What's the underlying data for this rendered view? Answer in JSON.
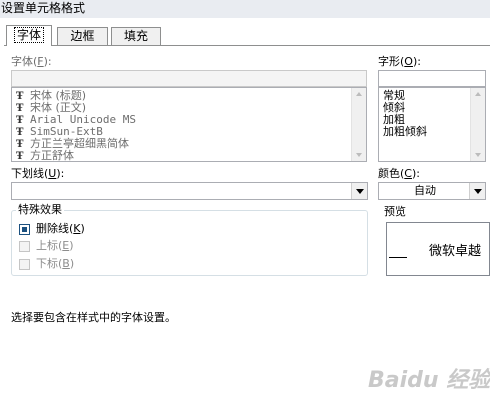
{
  "window": {
    "title": "设置单元格格式"
  },
  "tabs": [
    {
      "label": "字体",
      "active": true
    },
    {
      "label": "边框",
      "active": false
    },
    {
      "label": "填充",
      "active": false
    }
  ],
  "font": {
    "label": "字体",
    "accel": "F",
    "value": "",
    "items": [
      "宋体 (标题)",
      "宋体 (正文)",
      "Arial Unicode MS",
      "SimSun-ExtB",
      "方正兰亭超细黑简体",
      "方正舒体"
    ]
  },
  "font_style": {
    "label": "字形",
    "accel": "O",
    "value": "",
    "items": [
      "常规",
      "倾斜",
      "加粗",
      "加粗倾斜"
    ]
  },
  "underline": {
    "label": "下划线",
    "accel": "U",
    "value": ""
  },
  "color": {
    "label": "颜色",
    "accel": "C",
    "value": "自动"
  },
  "effects": {
    "title": "特殊效果",
    "strikethrough": {
      "label": "删除线",
      "accel": "K",
      "checked": true
    },
    "superscript": {
      "label": "上标",
      "accel": "E",
      "checked": false
    },
    "subscript": {
      "label": "下标",
      "accel": "B",
      "checked": false
    }
  },
  "preview": {
    "label": "预览",
    "sample": "微软卓越"
  },
  "description": "选择要包含在样式中的字体设置。",
  "watermark": "Baidu 经验",
  "colors": {
    "accent": "#1c5180",
    "tab_border": "#8e8f8f",
    "disabled_text": "#8d8d8d"
  }
}
